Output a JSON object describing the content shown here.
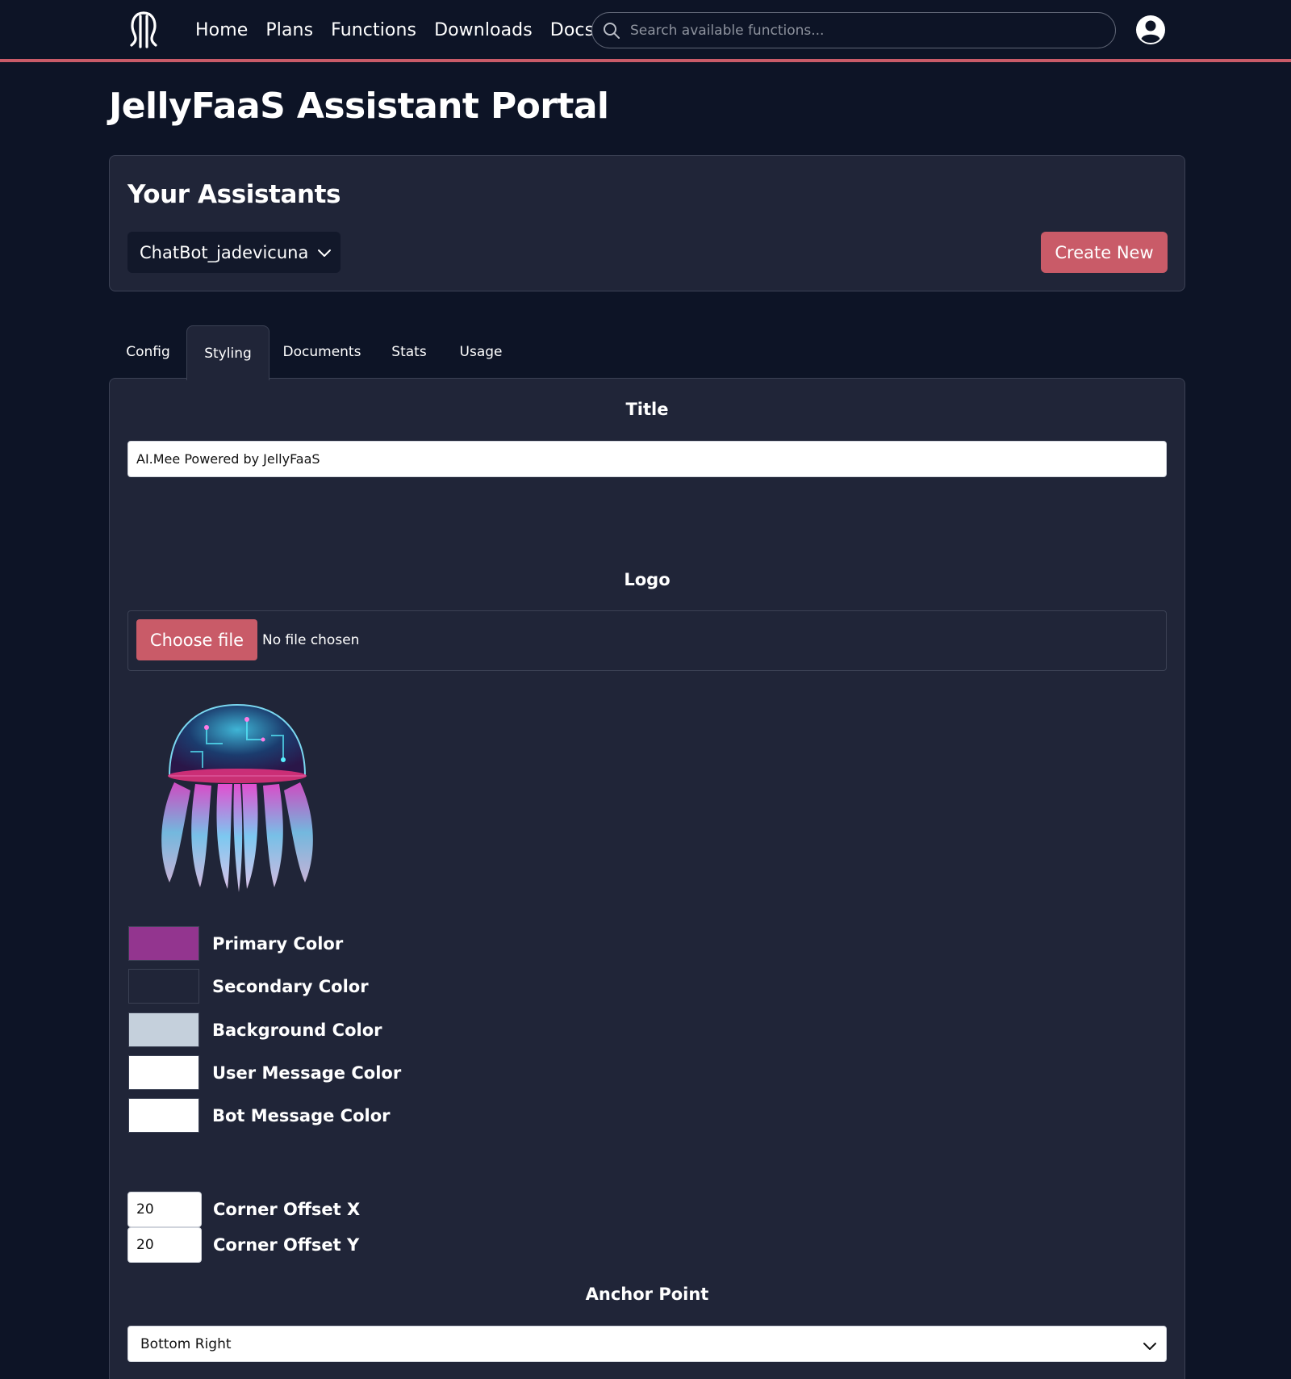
{
  "nav": {
    "logo_icon": "jellyfish-logo-icon",
    "links": [
      "Home",
      "Plans",
      "Functions",
      "Downloads",
      "Docs"
    ],
    "search_placeholder": "Search available functions...",
    "avatar_icon": "user-avatar-icon"
  },
  "page_title": "JellyFaaS Assistant Portal",
  "assistants": {
    "heading": "Your Assistants",
    "selected": "ChatBot_jadevicuna",
    "create_label": "Create New"
  },
  "tabs": [
    "Config",
    "Styling",
    "Documents",
    "Stats",
    "Usage"
  ],
  "active_tab": "Styling",
  "styling": {
    "title_label": "Title",
    "title_value": "AI.Mee Powered by JellyFaaS",
    "logo_label": "Logo",
    "choose_file_label": "Choose file",
    "file_status": "No file chosen",
    "colors": [
      {
        "label": "Primary Color",
        "value": "#93358f"
      },
      {
        "label": "Secondary Color",
        "value": "#202538"
      },
      {
        "label": "Background Color",
        "value": "#c5d0dc"
      },
      {
        "label": "User Message Color",
        "value": "#ffffff"
      },
      {
        "label": "Bot Message Color",
        "value": "#ffffff"
      }
    ],
    "offset_x_label": "Corner Offset X",
    "offset_x_value": "20",
    "offset_y_label": "Corner Offset Y",
    "offset_y_value": "20",
    "anchor_label": "Anchor Point",
    "anchor_value": "Bottom Right"
  },
  "theme": {
    "accent": "#c95b68",
    "page_bg": "#0d1426",
    "card_bg": "#202538"
  }
}
